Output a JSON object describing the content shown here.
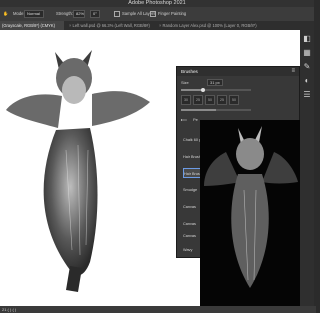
{
  "app": {
    "title": "Adobe Photoshop 2021"
  },
  "options": {
    "mode_label": "Mode:",
    "mode_value": "Normal",
    "strength_label": "Strength:",
    "strength_value": "82%",
    "angle_value": "0°",
    "sample_all_layers": "Sample All Layers",
    "finger_painting": "Finger Painting"
  },
  "tabs": [
    {
      "label": "(Grayscale, RGB/8*) (CMYK)",
      "active": true
    },
    {
      "label": "Left wall.psd @ 66.3% (Left Wall, RGB/8#)",
      "active": false
    },
    {
      "label": "Random Layer Alex.psd @ 100% (Layer 0, RGB/8*)",
      "active": false
    }
  ],
  "brushes_panel": {
    "title": "Brushes",
    "size_label": "Size",
    "size_value": "31 px",
    "brush_numbers": [
      "30",
      "25",
      "50",
      "25",
      "50"
    ],
    "folder_label": "Pe",
    "list": [
      "Chalk 60 px",
      "Hair Brush",
      "Hair Brush",
      "Smudge",
      "Canvas",
      "Canvas",
      "Canvas",
      "Wavy"
    ]
  },
  "status": {
    "text": "21 ( ) ( )"
  },
  "colors": {
    "app_bg": "#2b2b2b",
    "canvas_bg": "#ffffff",
    "panel_bg": "#383838",
    "selection": "#6c9be5"
  },
  "icons": [
    "search-icon",
    "home-icon",
    "brush-icon",
    "settings-icon",
    "layers-icon"
  ]
}
